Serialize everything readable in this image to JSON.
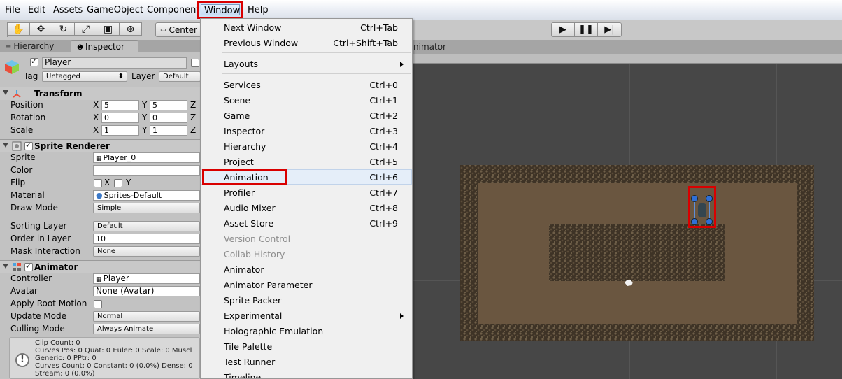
{
  "menubar": {
    "items": [
      "File",
      "Edit",
      "Assets",
      "GameObject",
      "Component",
      "Window",
      "Help"
    ]
  },
  "toolbar": {
    "tools": [
      "hand-icon",
      "move-icon",
      "rotate-icon",
      "scale-icon",
      "rect-icon",
      "transform-icon"
    ],
    "pivot_label": "Center",
    "play": [
      "play-icon",
      "pause-icon",
      "step-icon"
    ]
  },
  "tabs": {
    "hierarchy": "Hierarchy",
    "inspector": "Inspector",
    "animator_partial": "nimator"
  },
  "inspector": {
    "object_name": "Player",
    "tag_label": "Tag",
    "tag_value": "Untagged",
    "layer_label": "Layer",
    "layer_value": "Default",
    "transform": {
      "title": "Transform",
      "position_label": "Position",
      "rotation_label": "Rotation",
      "scale_label": "Scale",
      "x": "X",
      "y": "Y",
      "z": "Z",
      "position": [
        "5",
        "5"
      ],
      "rotation": [
        "0",
        "0"
      ],
      "scale": [
        "1",
        "1"
      ]
    },
    "sprite_renderer": {
      "title": "Sprite Renderer",
      "sprite_label": "Sprite",
      "sprite_value": "Player_0",
      "color_label": "Color",
      "flip_label": "Flip",
      "flip_x": "X",
      "flip_y": "Y",
      "material_label": "Material",
      "material_value": "Sprites-Default",
      "draw_mode_label": "Draw Mode",
      "draw_mode_value": "Simple",
      "sorting_layer_label": "Sorting Layer",
      "sorting_layer_value": "Default",
      "order_label": "Order in Layer",
      "order_value": "10",
      "mask_label": "Mask Interaction",
      "mask_value": "None"
    },
    "animator": {
      "title": "Animator",
      "controller_label": "Controller",
      "controller_value": "Player",
      "avatar_label": "Avatar",
      "avatar_value": "None (Avatar)",
      "root_motion_label": "Apply Root Motion",
      "update_mode_label": "Update Mode",
      "update_mode_value": "Normal",
      "culling_label": "Culling Mode",
      "culling_value": "Always Animate",
      "info": "Clip Count: 0\nCurves Pos: 0 Quat: 0 Euler: 0 Scale: 0 Muscl\nGeneric: 0 PPtr: 0\nCurves Count: 0 Constant: 0 (0.0%) Dense: 0\nStream: 0 (0.0%)"
    }
  },
  "window_menu": {
    "items": [
      {
        "label": "Next Window",
        "shortcut": "Ctrl+Tab"
      },
      {
        "label": "Previous Window",
        "shortcut": "Ctrl+Shift+Tab"
      },
      {
        "label": "Layouts",
        "shortcut": ""
      },
      {
        "label": "Services",
        "shortcut": "Ctrl+0"
      },
      {
        "label": "Scene",
        "shortcut": "Ctrl+1"
      },
      {
        "label": "Game",
        "shortcut": "Ctrl+2"
      },
      {
        "label": "Inspector",
        "shortcut": "Ctrl+3"
      },
      {
        "label": "Hierarchy",
        "shortcut": "Ctrl+4"
      },
      {
        "label": "Project",
        "shortcut": "Ctrl+5"
      },
      {
        "label": "Animation",
        "shortcut": "Ctrl+6"
      },
      {
        "label": "Profiler",
        "shortcut": "Ctrl+7"
      },
      {
        "label": "Audio Mixer",
        "shortcut": "Ctrl+8"
      },
      {
        "label": "Asset Store",
        "shortcut": "Ctrl+9"
      },
      {
        "label": "Version Control",
        "shortcut": ""
      },
      {
        "label": "Collab History",
        "shortcut": ""
      },
      {
        "label": "Animator",
        "shortcut": ""
      },
      {
        "label": "Animator Parameter",
        "shortcut": ""
      },
      {
        "label": "Sprite Packer",
        "shortcut": ""
      },
      {
        "label": "Experimental",
        "shortcut": ""
      },
      {
        "label": "Holographic Emulation",
        "shortcut": ""
      },
      {
        "label": "Tile Palette",
        "shortcut": ""
      },
      {
        "label": "Test Runner",
        "shortcut": ""
      },
      {
        "label": "Timeline",
        "shortcut": ""
      }
    ]
  },
  "colors": {
    "highlight_red": "#d90000",
    "dirt": "#6a5640",
    "stone": "#3e3326",
    "scene_bg": "#474747",
    "gizmo_blue": "#2f6fd6"
  }
}
